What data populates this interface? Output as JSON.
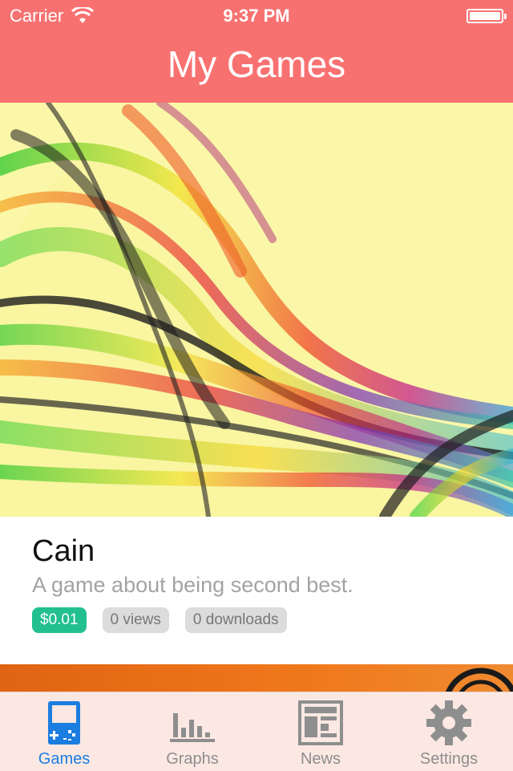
{
  "status_bar": {
    "carrier": "Carrier",
    "time": "9:37 PM"
  },
  "header": {
    "title": "My Games"
  },
  "game": {
    "title": "Cain",
    "description": "A game about being second best.",
    "price": "$0.01",
    "views": "0 views",
    "downloads": "0 downloads"
  },
  "tabs": [
    {
      "label": "Games",
      "icon": "gameboy-icon",
      "active": true
    },
    {
      "label": "Graphs",
      "icon": "bar-chart-icon",
      "active": false
    },
    {
      "label": "News",
      "icon": "newspaper-icon",
      "active": false
    },
    {
      "label": "Settings",
      "icon": "gear-icon",
      "active": false
    }
  ],
  "colors": {
    "header": "#f87171",
    "active_tab": "#1b7de0",
    "inactive_tab": "#8e8e8e",
    "price_badge": "#22c08f"
  }
}
